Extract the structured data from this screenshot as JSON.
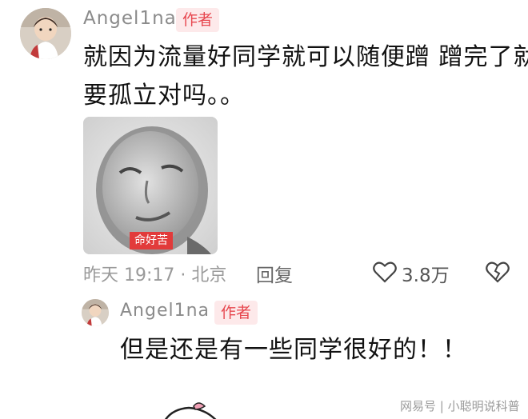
{
  "comment": {
    "username": "Angel1na",
    "author_tag": "作者",
    "text_line1": "就因为流量好同学就可以随便蹭 蹭完了就",
    "text_line2": "要孤立对吗。。",
    "meme_caption": "命好苦",
    "time": "昨天 19:17 · 北京",
    "reply_label": "回复",
    "likes": "3.8万"
  },
  "reply": {
    "username": "Angel1na",
    "author_tag": "作者",
    "text": "但是还是有一些同学很好的！！"
  },
  "watermark": "网易号 | 小聪明说科普",
  "icons": {
    "like": "heart-outline-icon",
    "dislike": "broken-heart-icon"
  }
}
